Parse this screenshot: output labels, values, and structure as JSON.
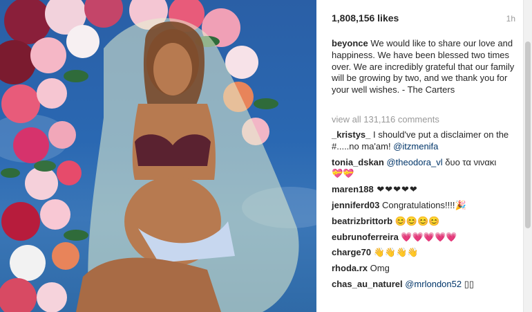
{
  "post": {
    "likes": "1,808,156 likes",
    "time": "1h",
    "caption_user": "beyonce",
    "caption_text": " We would like to share our love and happiness. We have been blessed two times over. We are incredibly grateful that our family will be growing by two, and we thank you for your well wishes. - The Carters",
    "view_all": "view all 131,116 comments"
  },
  "comments": [
    {
      "user": "_kristys_",
      "text": " I should've put a disclaimer on the #.....no ma'am! ",
      "mention": "@itzmenifa"
    },
    {
      "user": "tonia_dskan",
      "text": " ",
      "mention": "@theodora_vl",
      "text2": " δυο τα νινακι",
      "emoji": "💝💝"
    },
    {
      "user": "maren188",
      "text": " ❤❤❤❤❤"
    },
    {
      "user": "jenniferd03",
      "text": " Congratulations!!!!🎉"
    },
    {
      "user": "beatrizbrittorb",
      "text": " 😊😊😊😊"
    },
    {
      "user": "eubrunoferreira",
      "text": " 💗💗💗💗💗"
    },
    {
      "user": "charge70",
      "text": " 👋👋👋👋"
    },
    {
      "user": "rhoda.rx",
      "text": " Omg"
    },
    {
      "user": "chas_au_naturel",
      "text": " ",
      "mention": "@mrlondon52",
      "text2": " ▯▯"
    }
  ]
}
